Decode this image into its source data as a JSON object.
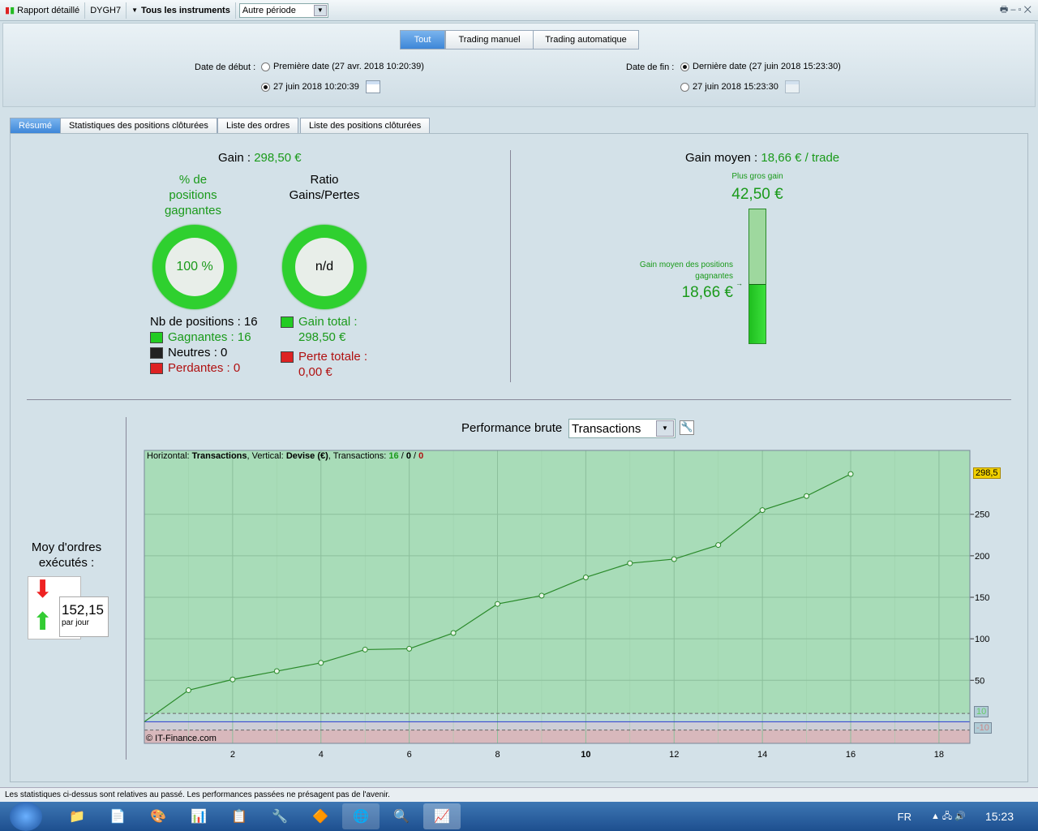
{
  "toolbar": {
    "report": "Rapport détaillé",
    "instrument": "DYGH7",
    "all_instruments": "Tous les instruments",
    "period": "Autre période"
  },
  "header": {
    "tabs": [
      "Tout",
      "Trading manuel",
      "Trading automatique"
    ],
    "start_label": "Date de début :",
    "start_first": "Première date (27 avr. 2018 10:20:39)",
    "start_custom": "27 juin 2018 10:20:39",
    "end_label": "Date de fin :",
    "end_last": "Dernière date (27 juin 2018 15:23:30)",
    "end_custom": "27 juin 2018 15:23:30"
  },
  "subtabs": [
    "Résumé",
    "Statistiques des positions clôturées",
    "Liste des ordres",
    "Liste des positions clôturées"
  ],
  "summary": {
    "gain_label": "Gain :",
    "gain": "298,50 €",
    "pct_label": "% de positions gagnantes",
    "pct": "100 %",
    "ratio_label": "Ratio Gains/Pertes",
    "ratio": "n/d",
    "nb_positions": "Nb de positions : 16",
    "winners": "Gagnantes : 16",
    "neutral": "Neutres : 0",
    "losers": "Perdantes : 0",
    "total_gain_label": "Gain total :",
    "total_gain": "298,50 €",
    "total_loss_label": "Perte totale :",
    "total_loss": "0,00 €",
    "avg_gain_label": "Gain moyen :",
    "avg_gain": "18,66 € / trade",
    "biggest_label": "Plus gros gain",
    "biggest": "42,50 €",
    "avg_win_label": "Gain moyen des positions gagnantes",
    "avg_win": "18,66 €",
    "avg_win_fraction": 0.44
  },
  "orders": {
    "label": "Moy d'ordres exécutés :",
    "value": "152,15",
    "unit": "par jour"
  },
  "perf": {
    "label": "Performance brute",
    "select": "Transactions"
  },
  "chart_data": {
    "type": "line",
    "title": "Horizontal: Transactions, Vertical: Devise (€), Transactions: 16 / 0 / 0",
    "legend_parts": {
      "h": "Horizontal:",
      "hv": "Transactions",
      "v": ", Vertical:",
      "vv": "Devise (€)",
      "t": ", Transactions:",
      "w": "16",
      "n": "0",
      "l": "0"
    },
    "x": [
      0,
      1,
      2,
      3,
      4,
      5,
      6,
      7,
      8,
      9,
      10,
      11,
      12,
      13,
      14,
      15,
      16
    ],
    "y": [
      0,
      38,
      51,
      61,
      71,
      87,
      88,
      107,
      142,
      152,
      174,
      191,
      196,
      213,
      255,
      272,
      298.5
    ],
    "xlim": [
      0,
      18.7
    ],
    "ylim": [
      -26,
      327
    ],
    "xticks": [
      2,
      4,
      6,
      8,
      10,
      12,
      14,
      16,
      18
    ],
    "yticks": [
      50,
      100,
      150,
      200,
      250
    ],
    "last_value": "298,5",
    "band_hi": "10",
    "band_lo": "-10",
    "copyright": "© IT-Finance.com",
    "colors": {
      "bg": "#a8dcb8",
      "line": "#2a8a2a",
      "loss": "#d8b8bc"
    }
  },
  "status": "Les statistiques ci-dessus sont relatives au passé. Les performances passées ne présagent pas de l'avenir.",
  "taskbar": {
    "lang": "FR",
    "time": "15:23"
  }
}
